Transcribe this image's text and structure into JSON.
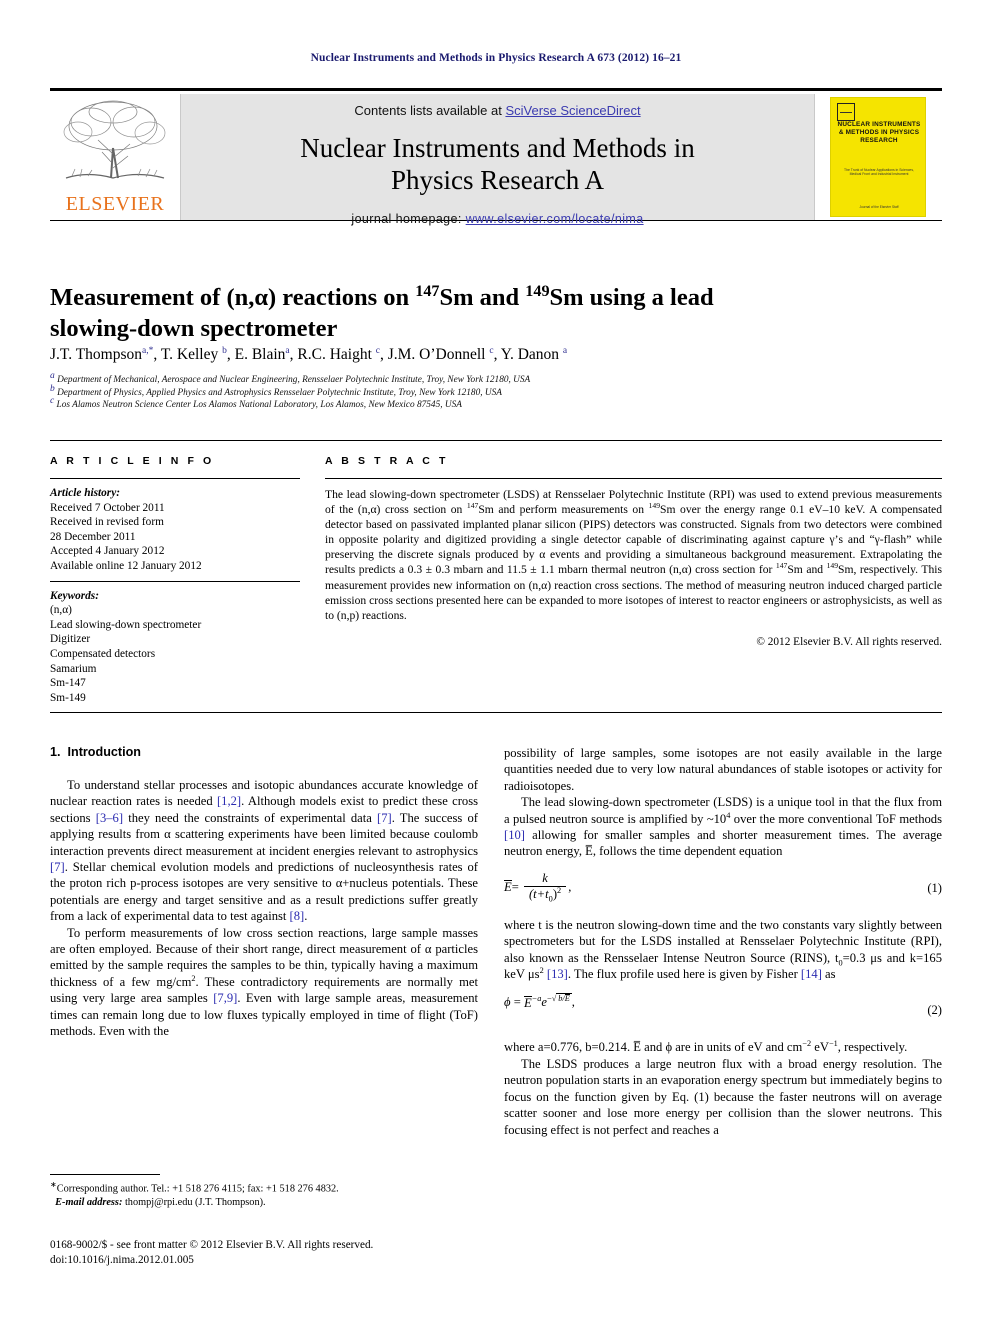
{
  "running_head": "Nuclear Instruments and Methods in Physics Research A 673 (2012) 16–21",
  "masthead": {
    "elsevier_wordmark": "ELSEVIER",
    "contents_prefix": "Contents lists available at ",
    "contents_link": "SciVerse ScienceDirect",
    "journal_title_line1": "Nuclear Instruments and Methods in",
    "journal_title_line2": "Physics Research A",
    "homepage_prefix": "journal homepage: ",
    "homepage_link": "www.elsevier.com/locate/nima",
    "cover": {
      "title": "NUCLEAR INSTRUMENTS & METHODS IN PHYSICS RESEARCH",
      "subtitle": "The Trunk of Nuclear Applications in Sciences, Medical Front and Industrial Instrument",
      "footer": "Journal of the Elsevier Staff"
    },
    "link_color": "#3b3bb0"
  },
  "article": {
    "title_line1": "Measurement of (n,α) reactions on ",
    "title_sup1": "147",
    "title_mid": "Sm and ",
    "title_sup2": "149",
    "title_end": "Sm using a lead",
    "title_line2": "slowing-down spectrometer",
    "authors": [
      {
        "name": "J.T. Thompson",
        "marks": "a,*"
      },
      {
        "name": "T. Kelley",
        "marks": "b"
      },
      {
        "name": "E. Blain",
        "marks": "a"
      },
      {
        "name": "R.C. Haight",
        "marks": "c"
      },
      {
        "name": "J.M. O’Donnell",
        "marks": "c"
      },
      {
        "name": "Y. Danon",
        "marks": "a"
      }
    ],
    "affiliations": [
      {
        "mark": "a",
        "text": "Department of Mechanical, Aerospace and Nuclear Engineering, Rensselaer Polytechnic Institute, Troy, New York 12180, USA"
      },
      {
        "mark": "b",
        "text": "Department of Physics, Applied Physics and Astrophysics Rensselaer Polytechnic Institute, Troy, New York 12180, USA"
      },
      {
        "mark": "c",
        "text": "Los Alamos Neutron Science Center Los Alamos National Laboratory, Los Alamos, New Mexico 87545, USA"
      }
    ]
  },
  "article_info": {
    "heading": "A R T I C L E  I N F O",
    "history_label": "Article history:",
    "history": [
      "Received 7 October 2011",
      "Received in revised form",
      "28 December 2011",
      "Accepted 4 January 2012",
      "Available online 12 January 2012"
    ],
    "keywords_label": "Keywords:",
    "keywords": [
      "(n,α)",
      "Lead slowing-down spectrometer",
      "Digitizer",
      "Compensated detectors",
      "Samarium",
      "Sm-147",
      "Sm-149"
    ]
  },
  "abstract": {
    "heading": "A B S T R A C T",
    "part1": "The lead slowing-down spectrometer (LSDS) at Rensselaer Polytechnic Institute (RPI) was used to extend previous measurements of the (n,α) cross section on ",
    "sup1": "147",
    "part2": "Sm and perform measurements on ",
    "sup2": "149",
    "part3": "Sm over the energy range 0.1 eV–10 keV. A compensated detector based on passivated implanted planar silicon (PIPS) detectors was constructed. Signals from two detectors were combined in opposite polarity and digitized providing a single detector capable of discriminating against capture γ’s and “γ-flash” while preserving the discrete signals produced by α events and providing a simultaneous background measurement. Extrapolating the results predicts a 0.3 ± 0.3 mbarn and 11.5 ± 1.1 mbarn thermal neutron (n,α) cross section for ",
    "sup3": "147",
    "part4": "Sm and ",
    "sup4": "149",
    "part5": "Sm, respectively. This measurement provides new information on (n,α) reaction cross sections. The method of measuring neutron induced charged particle emission cross sections presented here can be expanded to more isotopes of interest to reactor engineers or astrophysicists, as well as to (n,p) reactions.",
    "copyright": "© 2012 Elsevier B.V. All rights reserved."
  },
  "body": {
    "section_number": "1.",
    "section_title": "Introduction",
    "left_p1_a": "To understand stellar processes and isotopic abundances accurate knowledge of nuclear reaction rates is needed ",
    "left_p1_r1": "[1,2]",
    "left_p1_b": ". Although models exist to predict these cross sections ",
    "left_p1_r2": "[3–6]",
    "left_p1_c": " they need the constraints of experimental data ",
    "left_p1_r3": "[7]",
    "left_p1_d": ". The success of applying results from α scattering experiments have been limited because coulomb interaction prevents direct measurement at incident energies relevant to astrophysics ",
    "left_p1_r4": "[7]",
    "left_p1_e": ". Stellar chemical evolution models and predictions of nucleosynthesis rates of the proton rich p-process isotopes are very sensitive to α+nucleus potentials. These potentials are energy and target sensitive and as a result predictions suffer greatly from a lack of experimental data to test against ",
    "left_p1_r5": "[8]",
    "left_p1_f": ".",
    "left_p2_a": "To perform measurements of low cross section reactions, large sample masses are often employed. Because of their short range, direct measurement of α particles emitted by the sample requires the samples to be thin, typically having a maximum thickness of a few mg/cm",
    "left_p2_sup": "2",
    "left_p2_b": ". These contradictory requirements are normally met using very large area samples ",
    "left_p2_r1": "[7,9]",
    "left_p2_c": ". Even with large sample areas, measurement times can remain long due to low fluxes typically employed in time of flight (ToF) methods. Even with the",
    "right_p0": "possibility of large samples, some isotopes are not easily available in the large quantities needed due to very low natural abundances of stable isotopes or activity for radioisotopes.",
    "right_p1_a": "The lead slowing-down spectrometer (LSDS) is a unique tool in that the flux from a pulsed neutron source is amplified by ~10",
    "right_p1_sup": "4",
    "right_p1_b": " over the more conventional ToF methods ",
    "right_p1_r1": "[10]",
    "right_p1_c": " allowing for smaller samples and shorter measurement times. The average neutron energy, E̅, follows the time dependent equation",
    "eq1_num": "(1)",
    "eq1_lhs": "E",
    "eq1_numer": "k",
    "eq1_denom_t": "(t+t",
    "eq1_denom_sub": "0",
    "eq1_denom_end": ")",
    "eq1_denom_sup": "2",
    "eq1_comma": ",",
    "right_p2_a": "where t is the neutron slowing-down time and the two constants vary slightly between spectrometers but for the LSDS installed at Rensselaer Polytechnic Institute (RPI), also known as the Rensselaer Intense Neutron Source (RINS), t",
    "right_p2_sub": "0",
    "right_p2_b": "=0.3 μs and k=165 keV μs",
    "right_p2_sup": "2",
    "right_p2_c": " ",
    "right_p2_r1": "[13]",
    "right_p2_d": ". The flux profile used here is given by Fisher ",
    "right_p2_r2": "[14]",
    "right_p2_e": " as",
    "eq2_num": "(2)",
    "eq2_phi": "ϕ",
    "eq2_eq": "=",
    "eq2_E": "E",
    "eq2_Esup": "−a",
    "eq2_e": "e",
    "eq2_exp_minus": "−",
    "eq2_sqrt": "√",
    "eq2_radicand_b": "b/",
    "eq2_radicand_E": "E",
    "eq2_comma": ",",
    "right_p3_a": "where a=0.776, b=0.214. E̅ and ϕ are in units of eV and cm",
    "right_p3_sup1": "−2",
    "right_p3_b": " eV",
    "right_p3_sup2": "−1",
    "right_p3_c": ", respectively.",
    "right_p4": "The LSDS produces a large neutron flux with a broad energy resolution. The neutron population starts in an evaporation energy spectrum but immediately begins to focus on the function given by Eq. (1) because the faster neutrons will on average scatter sooner and lose more energy per collision than the slower neutrons. This focusing effect is not perfect and reaches a"
  },
  "footnote": {
    "mark": "∗",
    "line1": "Corresponding author. Tel.: +1 518 276 4115; fax: +1 518 276 4832.",
    "email_label": "E-mail address:",
    "email": " thompj@rpi.edu (J.T. Thompson)."
  },
  "footer": {
    "issn_line": "0168-9002/$ - see front matter © 2012 Elsevier B.V. All rights reserved.",
    "doi_line": "doi:10.1016/j.nima.2012.01.005"
  }
}
